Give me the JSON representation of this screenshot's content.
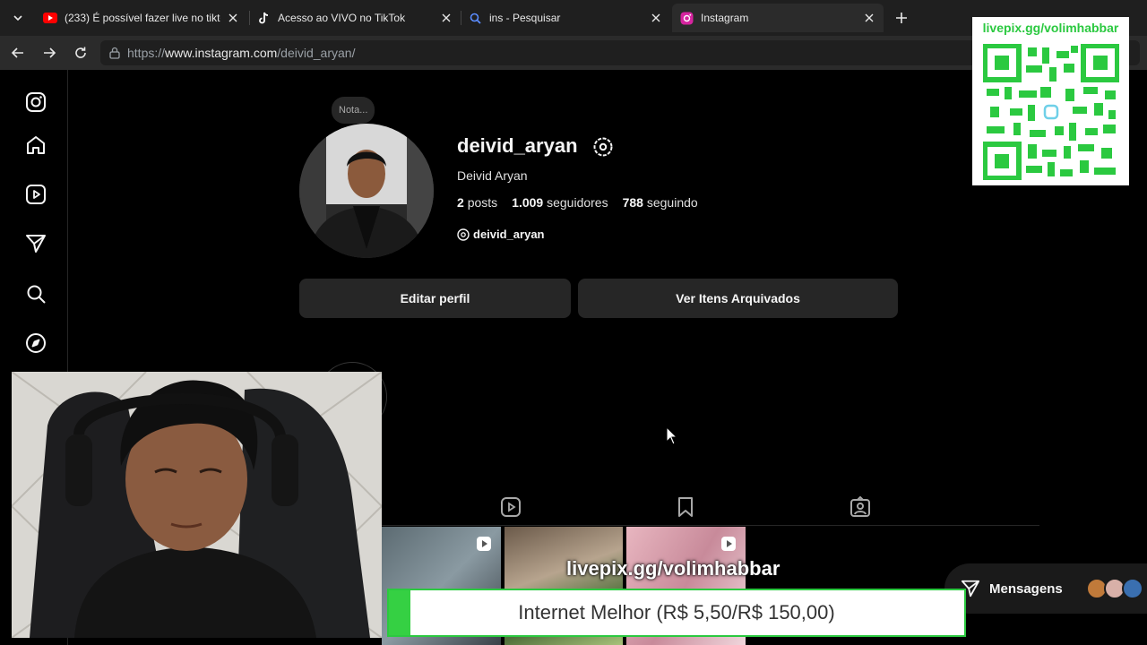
{
  "browser": {
    "tabs": [
      {
        "title": "(233) É possível fazer live no tiktok",
        "icon": "youtube-icon",
        "active": false
      },
      {
        "title": "Acesso ao VIVO no TikTok",
        "icon": "tiktok-icon",
        "active": false
      },
      {
        "title": "ins - Pesquisar",
        "icon": "search-icon",
        "active": false
      },
      {
        "title": "Instagram",
        "icon": "instagram-icon",
        "active": true
      }
    ],
    "url_prefix": "https://",
    "url_host": "www.instagram.com",
    "url_path": "/deivid_aryan/"
  },
  "profile": {
    "note": "Nota...",
    "username": "deivid_aryan",
    "full_name": "Deivid Aryan",
    "posts_count": "2",
    "posts_label": "posts",
    "followers_count": "1.009",
    "followers_label": "seguidores",
    "following_count": "788",
    "following_label": "seguindo",
    "threads_handle": "deivid_aryan",
    "edit_button": "Editar perfil",
    "archive_button": "Ver Itens Arquivados"
  },
  "sidebar_icons": [
    "instagram-logo-icon",
    "home-icon",
    "reels-icon",
    "messages-icon",
    "search-icon",
    "explore-icon"
  ],
  "profile_tabs_icons": [
    "reels-icon",
    "saved-icon",
    "tagged-icon"
  ],
  "messages": {
    "label": "Mensagens"
  },
  "overlay": {
    "qr_url": "livepix.gg/volimhabbar",
    "stream_url": "livepix.gg/volimhabbar",
    "goal_text": "Internet Melhor (R$ 5,50/R$ 150,00)",
    "goal_progress": 0.0367
  },
  "colors": {
    "accent_green": "#35d043",
    "ig_bg": "#000000",
    "button_bg": "#262626"
  }
}
